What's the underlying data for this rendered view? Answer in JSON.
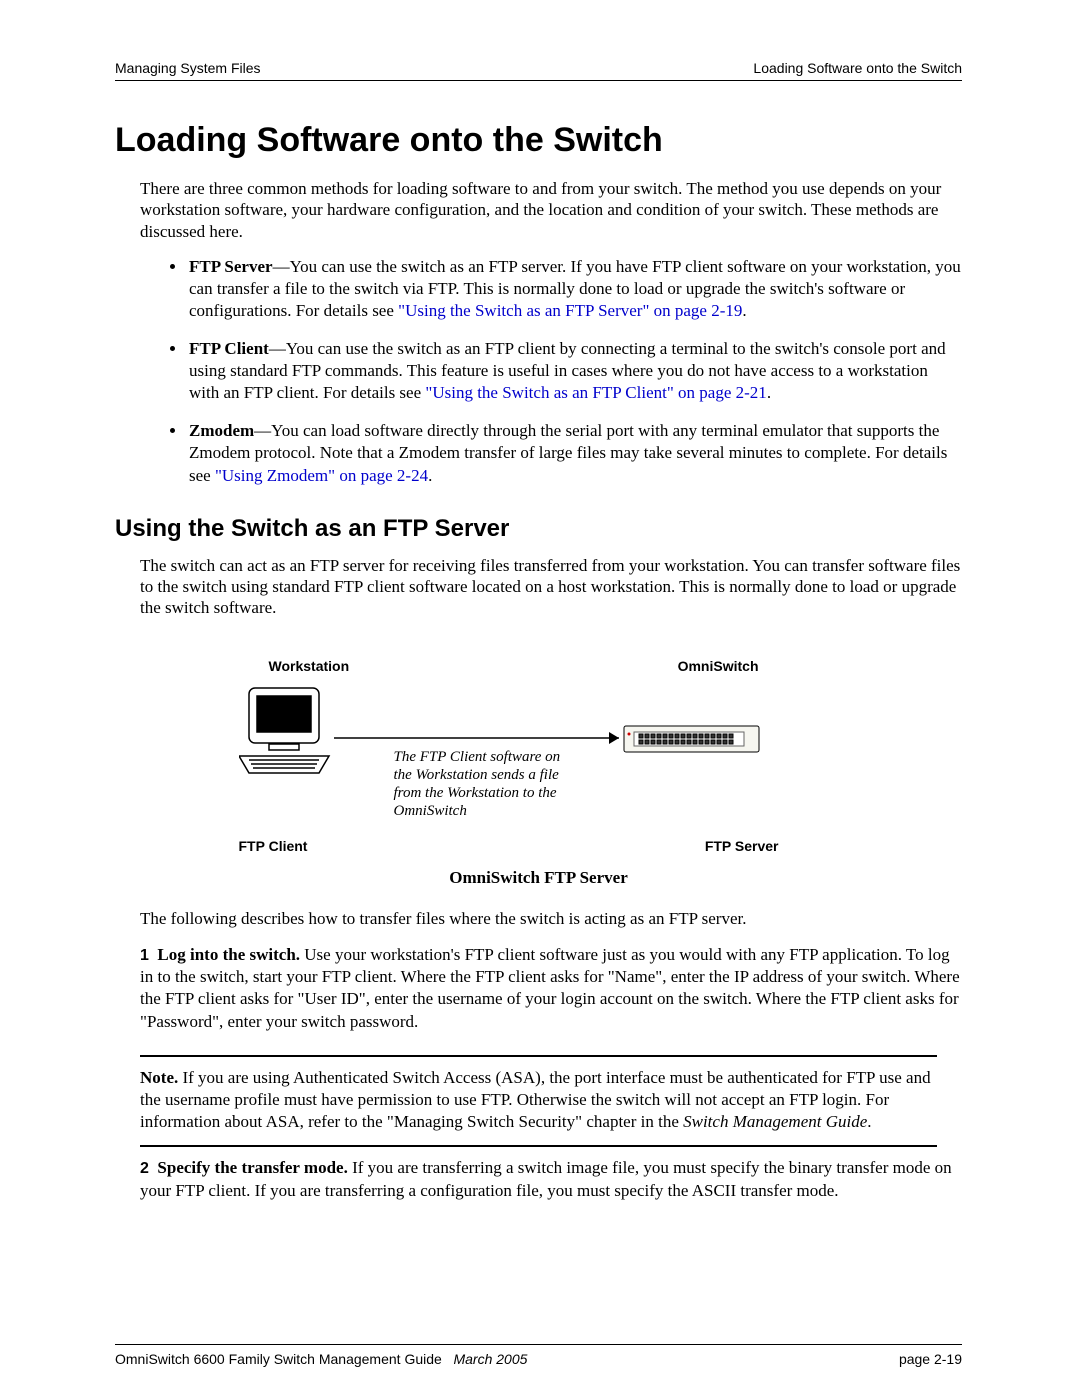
{
  "header": {
    "left": "Managing System Files",
    "right": "Loading Software onto the Switch"
  },
  "title": "Loading Software onto the Switch",
  "intro": "There are three common methods for loading software to and from your switch. The method you use depends on your workstation software, your hardware configuration, and the location and condition of your switch. These methods are discussed here.",
  "bullets": {
    "b1_bold": "FTP Server",
    "b1_text": "—You can use the switch as an FTP server. If you have FTP client software on your workstation, you can transfer a file to the switch via FTP. This is normally done to load or upgrade the switch's software or configurations. For details see ",
    "b1_link": "\"Using the Switch as an FTP Server\" on page 2-19",
    "b2_bold": "FTP Client",
    "b2_text": "—You can use the switch as an FTP client by connecting a terminal to the switch's console port and using standard FTP commands. This feature is useful in cases where you do not have access to a workstation with an FTP client. For details see ",
    "b2_link": "\"Using the Switch as an FTP Client\" on page 2-21",
    "b3_bold": "Zmodem",
    "b3_text": "—You can load software directly through the serial port with any terminal emulator that supports the Zmodem protocol. Note that a Zmodem transfer of large files may take several minutes to complete. For details see ",
    "b3_link": "\"Using Zmodem\" on page 2-24"
  },
  "section2": {
    "heading": "Using the Switch as an FTP Server",
    "para": "The switch can act as an FTP server for receiving files transferred from your workstation. You can transfer software files to the switch using standard FTP client software located on a host workstation. This is normally done to load or upgrade the switch software."
  },
  "diagram": {
    "workstation": "Workstation",
    "omniswitch": "OmniSwitch",
    "ftpclient": "FTP Client",
    "ftpserver": "FTP Server",
    "caption": "The FTP Client software on the Workstation sends a file from the Workstation to the OmniSwitch",
    "figure_title": "OmniSwitch FTP Server"
  },
  "after_fig": "The following describes how to transfer files where the switch is acting as an FTP server.",
  "step1": {
    "num": "1",
    "bold": "Log into the switch.",
    "text": " Use your workstation's FTP client software just as you would with any FTP application. To log in to the switch, start your FTP client. Where the FTP client asks for \"Name\", enter the IP address of your switch. Where the FTP client asks for \"User ID\", enter the username of your login account on the switch. Where the FTP client asks for \"Password\", enter your switch password."
  },
  "note": {
    "label": "Note.",
    "text": " If you are using Authenticated Switch Access (ASA), the port interface must be authenticated for FTP use and the username profile must have permission to use FTP. Otherwise the switch will not accept an FTP login. For information about ASA, refer to the \"Managing Switch Security\" chapter in the ",
    "italic": "Switch Management Guide",
    "end": "."
  },
  "step2": {
    "num": "2",
    "bold": "Specify the transfer mode.",
    "text": " If you are transferring a switch image file, you must specify the binary transfer mode on your FTP client. If you are transferring a configuration file, you must specify the ASCII transfer mode."
  },
  "footer": {
    "title": "OmniSwitch 6600 Family Switch Management Guide",
    "date": "March 2005",
    "page": "page 2-19"
  }
}
